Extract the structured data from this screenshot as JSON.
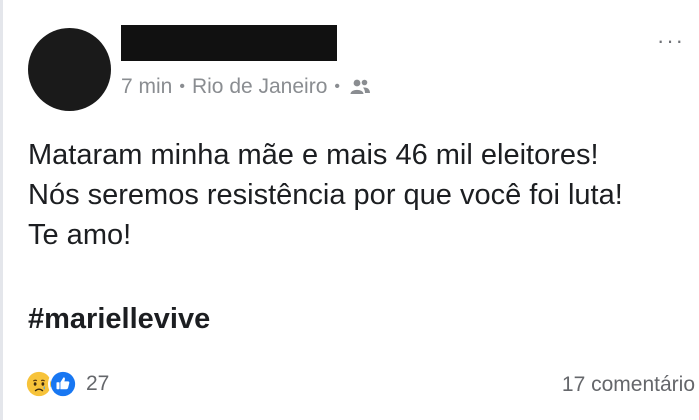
{
  "post": {
    "meta": {
      "time": "7 min",
      "separator": "•",
      "location": "Rio de Janeiro"
    },
    "more_label": "···",
    "text_lines": [
      "Mataram minha mãe e mais 46 mil eleitores!",
      "Nós seremos resistência por que você foi luta!",
      "Te amo!"
    ],
    "hashtag": "#mariellevive",
    "reactions": {
      "icons": [
        "sad-reaction-icon",
        "like-reaction-icon"
      ],
      "count": "27"
    },
    "comments": "17 comentário"
  },
  "colors": {
    "like_blue": "#1877f2",
    "sad_yellow": "#f7c33a",
    "meta_gray": "#8a8d91",
    "text": "#1c1e21"
  }
}
